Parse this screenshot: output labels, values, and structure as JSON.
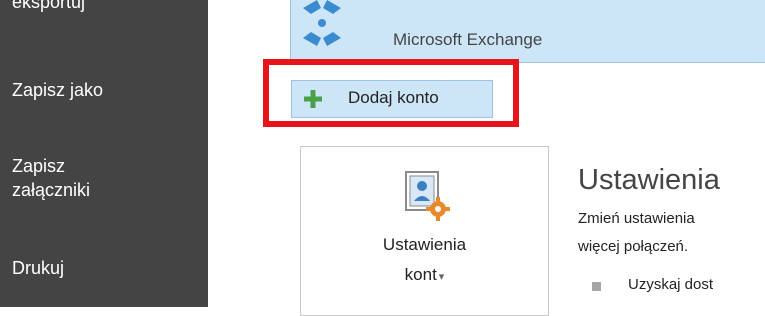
{
  "sidebar": {
    "items": [
      {
        "label": "eksportuj"
      },
      {
        "label": "Zapisz jako"
      },
      {
        "label": "Zapisz"
      },
      {
        "label": "załączniki"
      },
      {
        "label": "Drukuj"
      }
    ]
  },
  "account": {
    "type_label": "Microsoft Exchange",
    "icon": "exchange-icon"
  },
  "add_account": {
    "label": "Dodaj konto",
    "icon": "plus-icon"
  },
  "settings_tile": {
    "line1": "Ustawienia",
    "line2": "kont",
    "caret": "▾",
    "icon": "account-settings-icon"
  },
  "settings_section": {
    "title": "Ustawienia",
    "desc1": "Zmień ustawienia",
    "desc2": "więcej połączeń.",
    "bullet1": "Uzyskaj dost"
  },
  "colors": {
    "sidebar_bg": "#444444",
    "highlight": "#e8141c",
    "selected_bg": "#cde6f7"
  }
}
